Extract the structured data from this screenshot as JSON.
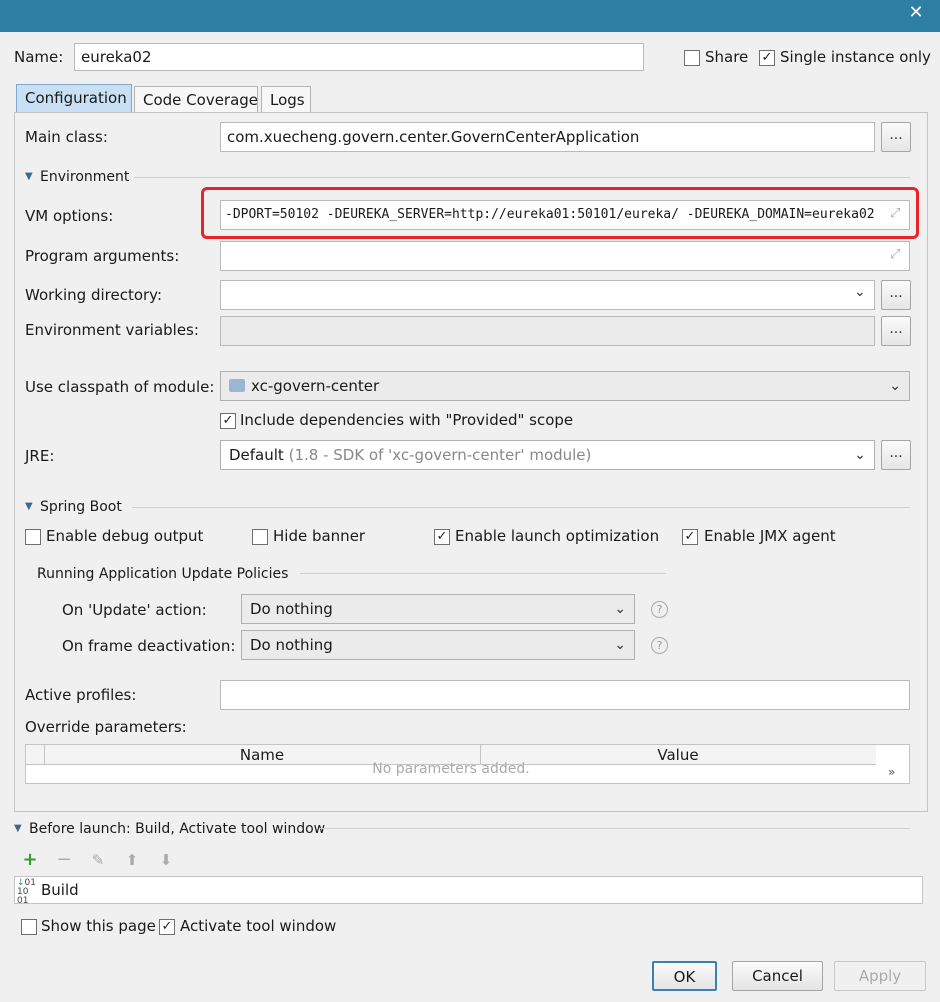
{
  "window": {
    "close_icon": "close-icon"
  },
  "header": {
    "name_label": "Name:",
    "name_value": "eureka02",
    "share_label": "Share",
    "share_checked": false,
    "single_instance_label": "Single instance only",
    "single_instance_checked": true
  },
  "tabs": [
    {
      "label": "Configuration",
      "active": true
    },
    {
      "label": "Code Coverage",
      "active": false
    },
    {
      "label": "Logs",
      "active": false
    }
  ],
  "config": {
    "main_class_label": "Main class:",
    "main_class_value": "com.xuecheng.govern.center.GovernCenterApplication",
    "environment_title": "Environment",
    "vm_options_label": "VM options:",
    "vm_options_value": "-DPORT=50102 -DEUREKA_SERVER=http://eureka01:50101/eureka/ -DEUREKA_DOMAIN=eureka02",
    "program_args_label": "Program arguments:",
    "program_args_value": "",
    "working_dir_label": "Working directory:",
    "working_dir_value": "",
    "env_vars_label": "Environment variables:",
    "env_vars_value": "",
    "classpath_label": "Use classpath of module:",
    "classpath_value": "xc-govern-center",
    "include_deps_label": "Include dependencies with \"Provided\" scope",
    "include_deps_checked": true,
    "jre_label": "JRE:",
    "jre_value": "Default",
    "jre_hint": "(1.8 - SDK of 'xc-govern-center' module)",
    "dots": "..."
  },
  "spring_boot": {
    "title": "Spring Boot",
    "debug_output": "Enable debug output",
    "hide_banner": "Hide banner",
    "launch_optimization": "Enable launch optimization",
    "jmx_agent": "Enable JMX agent",
    "policies_title": "Running Application Update Policies",
    "on_update_label": "On 'Update' action:",
    "on_update_value": "Do nothing",
    "on_frame_label": "On frame deactivation:",
    "on_frame_value": "Do nothing",
    "active_profiles_label": "Active profiles:",
    "active_profiles_value": "",
    "override_label": "Override parameters:",
    "table_headers": [
      "Name",
      "Value"
    ],
    "empty_text": "No parameters added.",
    "expand_glyph": "»"
  },
  "before_launch": {
    "title": "Before launch: Build, Activate tool window",
    "tools": [
      "add-icon",
      "remove-icon",
      "edit-icon",
      "move-up-icon",
      "move-down-icon"
    ],
    "items": [
      {
        "label": "Build",
        "icon": "build-icon"
      }
    ]
  },
  "footer": {
    "show_page_label": "Show this page",
    "show_page_checked": false,
    "activate_label": "Activate tool window",
    "activate_checked": true,
    "ok": "OK",
    "cancel": "Cancel",
    "apply": "Apply"
  },
  "colors": {
    "titlebar": "#2e7fa4",
    "highlight_box": "#e8242a",
    "active_tab": "#c9e0f4"
  }
}
